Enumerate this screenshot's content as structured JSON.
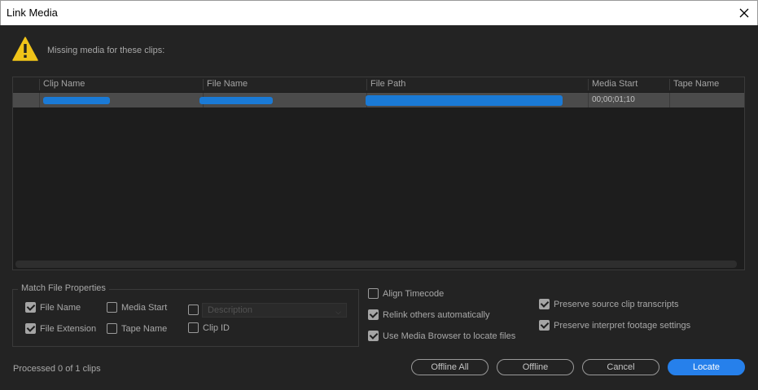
{
  "window": {
    "title": "Link Media"
  },
  "warning": {
    "text": "Missing media for these clips:"
  },
  "table": {
    "columns": [
      "Clip Name",
      "File Name",
      "File Path",
      "Media Start",
      "Tape Name"
    ],
    "rows": [
      {
        "clip_name": "",
        "file_name": "",
        "file_path": "",
        "media_start": "00;00;01;10",
        "tape_name": ""
      }
    ]
  },
  "match_properties": {
    "legend": "Match File Properties",
    "file_name": {
      "label": "File Name",
      "checked": true
    },
    "file_extension": {
      "label": "File Extension",
      "checked": true
    },
    "media_start": {
      "label": "Media Start",
      "checked": false
    },
    "tape_name": {
      "label": "Tape Name",
      "checked": false
    },
    "description": {
      "label": "",
      "checked": false,
      "placeholder": "Description"
    },
    "clip_id": {
      "label": "Clip ID",
      "checked": false
    }
  },
  "options": {
    "align_timecode": {
      "label": "Align Timecode",
      "checked": false
    },
    "relink_others": {
      "label": "Relink others automatically",
      "checked": true
    },
    "use_media_browser": {
      "label": "Use Media Browser to locate files",
      "checked": true
    },
    "preserve_transcripts": {
      "label": "Preserve source clip transcripts",
      "checked": true
    },
    "preserve_interpret": {
      "label": "Preserve interpret footage settings",
      "checked": true
    }
  },
  "status": {
    "text": "Processed 0 of 1 clips"
  },
  "buttons": {
    "offline_all": "Offline All",
    "offline": "Offline",
    "cancel": "Cancel",
    "locate": "Locate"
  },
  "colors": {
    "accent": "#2680eb",
    "background": "#232323",
    "warning": "#f0c419",
    "redaction": "#1a7ad6"
  }
}
